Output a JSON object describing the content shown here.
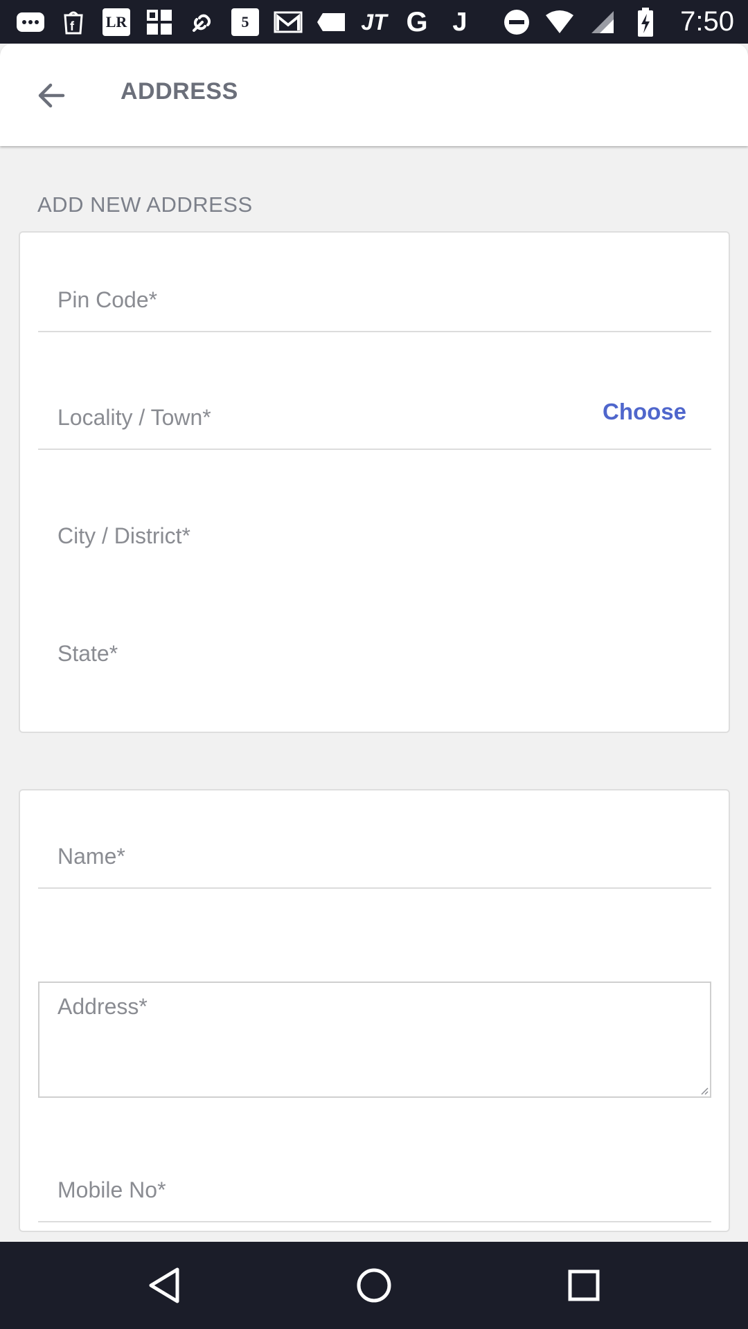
{
  "status_bar": {
    "time": "7:50",
    "notification_icons": [
      "more-icon",
      "food-app-icon",
      "lr-app-icon",
      "grid-app-icon",
      "link-app-icon",
      "five-app-icon",
      "mail-icon",
      "tag-icon",
      "jt-app-icon",
      "google-icon",
      "j-app-icon"
    ],
    "system_icons": [
      "do-not-disturb-icon",
      "wifi-icon",
      "signal-icon",
      "battery-charging-icon"
    ],
    "lr_label": "LR",
    "five_label": "5",
    "jt_label": "JT",
    "g_label": "G",
    "j_label": "J"
  },
  "app_bar": {
    "title": "ADDRESS"
  },
  "section": {
    "heading": "ADD NEW ADDRESS"
  },
  "location_card": {
    "pin_code_placeholder": "Pin Code*",
    "locality_placeholder": "Locality / Town*",
    "choose_label": "Choose",
    "city_placeholder": "City / District*",
    "state_placeholder": "State*"
  },
  "contact_card": {
    "name_placeholder": "Name*",
    "address_placeholder": "Address*",
    "mobile_placeholder": "Mobile No*"
  },
  "colors": {
    "accent": "#4f66cc",
    "status_bar_bg": "#1b1d29",
    "page_bg": "#f1f1f1"
  }
}
